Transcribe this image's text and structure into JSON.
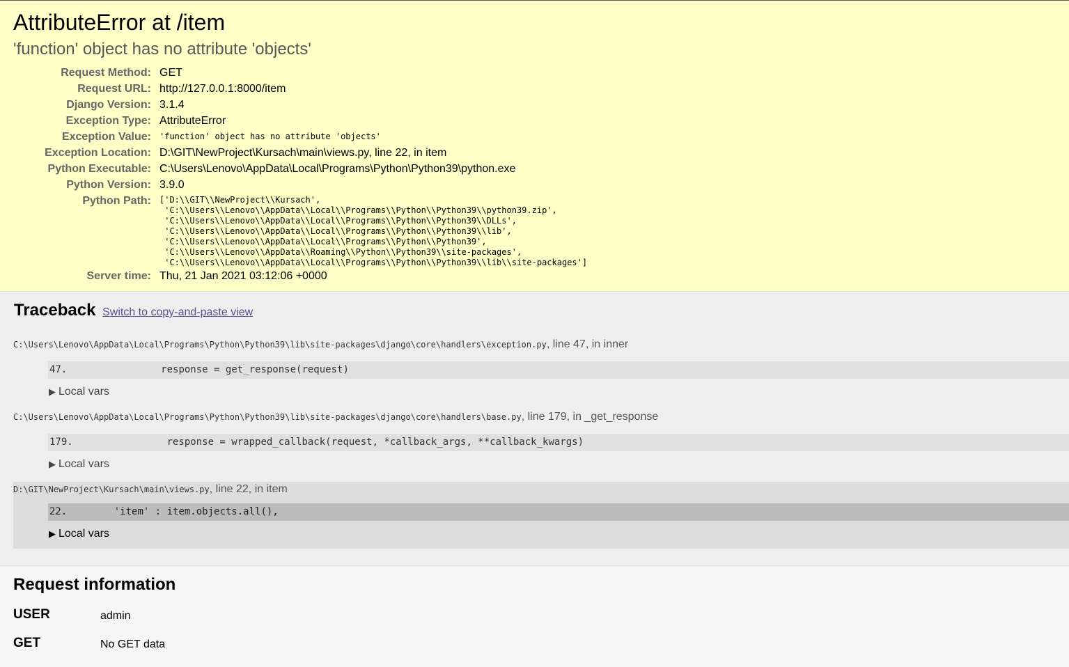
{
  "summary": {
    "title": "AttributeError at /item",
    "subtitle": "'function' object has no attribute 'objects'",
    "meta": [
      {
        "label": "Request Method:",
        "value": "GET"
      },
      {
        "label": "Request URL:",
        "value": "http://127.0.0.1:8000/item"
      },
      {
        "label": "Django Version:",
        "value": "3.1.4"
      },
      {
        "label": "Exception Type:",
        "value": "AttributeError"
      },
      {
        "label": "Exception Value:",
        "value": "'function' object has no attribute 'objects'"
      },
      {
        "label": "Exception Location:",
        "value": "D:\\GIT\\NewProject\\Kursach\\main\\views.py, line 22, in item"
      },
      {
        "label": "Python Executable:",
        "value": "C:\\Users\\Lenovo\\AppData\\Local\\Programs\\Python\\Python39\\python.exe"
      },
      {
        "label": "Python Version:",
        "value": "3.9.0"
      },
      {
        "label": "Python Path:",
        "value": "['D:\\\\GIT\\\\NewProject\\\\Kursach',\n 'C:\\\\Users\\\\Lenovo\\\\AppData\\\\Local\\\\Programs\\\\Python\\\\Python39\\\\python39.zip',\n 'C:\\\\Users\\\\Lenovo\\\\AppData\\\\Local\\\\Programs\\\\Python\\\\Python39\\\\DLLs',\n 'C:\\\\Users\\\\Lenovo\\\\AppData\\\\Local\\\\Programs\\\\Python\\\\Python39\\\\lib',\n 'C:\\\\Users\\\\Lenovo\\\\AppData\\\\Local\\\\Programs\\\\Python\\\\Python39',\n 'C:\\\\Users\\\\Lenovo\\\\AppData\\\\Roaming\\\\Python\\\\Python39\\\\site-packages',\n 'C:\\\\Users\\\\Lenovo\\\\AppData\\\\Local\\\\Programs\\\\Python\\\\Python39\\\\lib\\\\site-packages']"
      },
      {
        "label": "Server time:",
        "value": "Thu, 21 Jan 2021 03:12:06 +0000"
      }
    ]
  },
  "traceback": {
    "heading": "Traceback",
    "switch_link": "Switch to copy-and-paste view",
    "local_vars_label": "Local vars",
    "frames": [
      {
        "file": "C:\\Users\\Lenovo\\AppData\\Local\\Programs\\Python\\Python39\\lib\\site-packages\\django\\core\\handlers\\exception.py",
        "where": ", line 47, in inner",
        "line_no": "47.",
        "code": "                response = get_response(request)"
      },
      {
        "file": "C:\\Users\\Lenovo\\AppData\\Local\\Programs\\Python\\Python39\\lib\\site-packages\\django\\core\\handlers\\base.py",
        "where": ", line 179, in _get_response",
        "line_no": "179.",
        "code": "                response = wrapped_callback(request, *callback_args, **callback_kwargs)"
      },
      {
        "file": "D:\\GIT\\NewProject\\Kursach\\main\\views.py",
        "where": ", line 22, in item",
        "line_no": "22.",
        "code": "        'item' : item.objects.all(),"
      }
    ]
  },
  "request_info": {
    "heading": "Request information",
    "rows": [
      {
        "key": "USER",
        "value": "admin"
      },
      {
        "key": "GET",
        "value": "No GET data"
      }
    ]
  }
}
